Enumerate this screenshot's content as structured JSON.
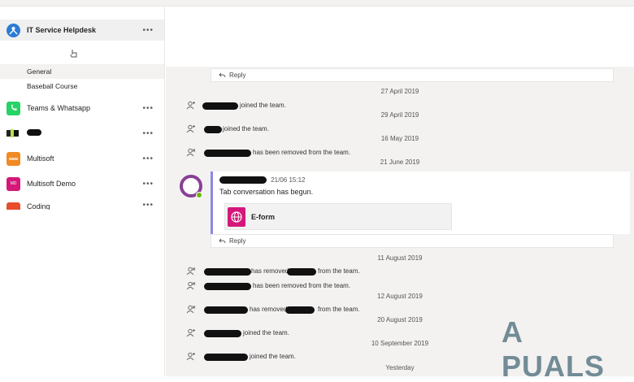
{
  "sidebar": {
    "teams": [
      {
        "name": "IT Service Helpdesk",
        "icon": "person-network-icon",
        "color": "#2b7bd6",
        "active": true
      },
      {
        "name": "Teams & Whatsapp",
        "icon": "phone-icon",
        "color": "#25d366"
      },
      {
        "name": "",
        "icon": "multi-color-icon",
        "color": "#222222"
      },
      {
        "name": "Multisoft",
        "icon": "multisoft-logo-icon",
        "color": "#f08a24"
      },
      {
        "name": "Multisoft Demo",
        "icon_text": "MD",
        "color": "#d4187a"
      },
      {
        "name": "Coding",
        "icon": "coding-icon",
        "color": "#e84c2b"
      }
    ],
    "channels": [
      {
        "name": "General",
        "selected": true
      },
      {
        "name": "Baseball Course"
      }
    ],
    "more_label": "•••"
  },
  "feed": {
    "reply_label": "Reply",
    "dates": {
      "d1": "27 April 2019",
      "d2": "29 April 2019",
      "d3": "16 May 2019",
      "d4": "21 June 2019",
      "d5": "11 August 2019",
      "d6": "12 August 2019",
      "d7": "20 August 2019",
      "d8": "10 September 2019",
      "d9": "Yesterday"
    },
    "events": {
      "joined": "joined the team.",
      "removed": "has been removed from the team.",
      "has_removed": "has removed",
      "from_team": "from the team."
    },
    "post": {
      "time": "21/06 15:12",
      "text": "Tab conversation has begun.",
      "card_title": "E-form"
    }
  },
  "watermark": "A PUALS",
  "colors": {
    "accent": "#6264a7",
    "feed_bg": "#f3f2f1"
  }
}
